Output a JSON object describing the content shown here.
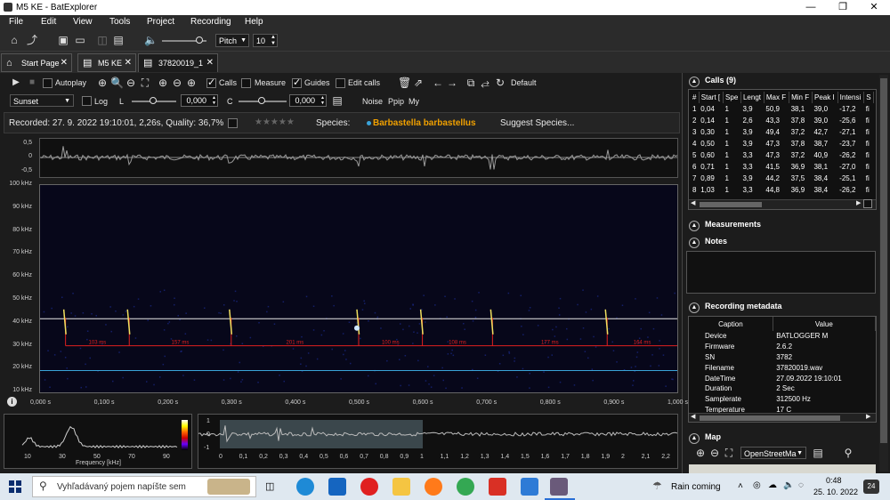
{
  "window": {
    "title": "M5 KE - BatExplorer",
    "minimize": "—",
    "maximize": "❐",
    "close": "✕"
  },
  "menu": [
    "File",
    "Edit",
    "View",
    "Tools",
    "Project",
    "Recording",
    "Help"
  ],
  "toolbar": {
    "pitch_label": "Pitch",
    "pitch_value": "10",
    "volume_level": 0.6
  },
  "tabs": [
    {
      "label": "Start Page",
      "icon": "home-icon"
    },
    {
      "label": "M5 KE",
      "icon": "project-icon"
    },
    {
      "label": "37820019_1",
      "icon": "recording-icon"
    }
  ],
  "controls": {
    "autoplay": "Autoplay",
    "calls": "Calls",
    "measure": "Measure",
    "guides": "Guides",
    "edit_calls": "Edit calls",
    "default": "Default",
    "palette": "Sunset",
    "log": "Log",
    "l_label": "L",
    "l_value": "0,000",
    "c_label": "C",
    "c_value": "0,000",
    "noise": "Noise",
    "ppip": "Ppip",
    "my": "My"
  },
  "info": {
    "recorded": "Recorded: 27. 9. 2022 19:10:01, 2,26s, Quality: 36,7%",
    "stars": "★★★★★",
    "species_label": "Species:",
    "species_value": "Barbastella barbastellus",
    "suggest": "Suggest Species..."
  },
  "waveform_ticks": [
    "0,5",
    "0",
    "-0,5"
  ],
  "spectrogram": {
    "freq_labels": [
      "100 kHz",
      "90 kHz",
      "80 kHz",
      "70 kHz",
      "60 kHz",
      "50 kHz",
      "40 kHz",
      "30 kHz",
      "20 kHz",
      "10 kHz"
    ],
    "time_labels": [
      "0,000 s",
      "0,100 s",
      "0,200 s",
      "0,300 s",
      "0,400 s",
      "0,500 s",
      "0,600 s",
      "0,700 s",
      "0,800 s",
      "0,900 s",
      "1,000 s"
    ],
    "intervals": [
      "103 ms",
      "157 ms",
      "201 ms",
      "100 ms",
      "108 ms",
      "177 ms",
      "164 ms"
    ],
    "call_times": [
      0.04,
      0.14,
      0.3,
      0.5,
      0.6,
      0.71,
      0.89
    ],
    "colors": {
      "guide_white": "#e8e8e8",
      "guide_blue": "#3aa3d8",
      "call_marker": "#e02020",
      "call_trace": "#f0e060",
      "species": "#f0a000"
    }
  },
  "spectrum": {
    "x_labels": [
      "10",
      "30",
      "50",
      "70",
      "90"
    ],
    "xlabel": "Frequency [kHz]"
  },
  "overview": {
    "y_labels": [
      "1",
      "0",
      "-1"
    ],
    "x_labels": [
      "0",
      "0,1",
      "0,2",
      "0,3",
      "0,4",
      "0,5",
      "0,6",
      "0,7",
      "0,8",
      "0,9",
      "1",
      "1,1",
      "1,2",
      "1,3",
      "1,4",
      "1,5",
      "1,6",
      "1,7",
      "1,8",
      "1,9",
      "2",
      "2,1",
      "2,2"
    ]
  },
  "calls_panel": {
    "title": "Calls (9)",
    "headers": [
      "#",
      "Start [",
      "Spe",
      "Lengt",
      "Max F",
      "Min F",
      "Peak I",
      "Intensi",
      "S"
    ],
    "rows": [
      [
        "1",
        "0,04",
        "1",
        "3,9",
        "50,9",
        "38,1",
        "39,0",
        "-17,2",
        "fi"
      ],
      [
        "2",
        "0,14",
        "1",
        "2,6",
        "43,3",
        "37,8",
        "39,0",
        "-25,6",
        "fi"
      ],
      [
        "3",
        "0,30",
        "1",
        "3,9",
        "49,4",
        "37,2",
        "42,7",
        "-27,1",
        "fi"
      ],
      [
        "4",
        "0,50",
        "1",
        "3,9",
        "47,3",
        "37,8",
        "38,7",
        "-23,7",
        "fi"
      ],
      [
        "5",
        "0,60",
        "1",
        "3,3",
        "47,3",
        "37,2",
        "40,9",
        "-26,2",
        "fi"
      ],
      [
        "6",
        "0,71",
        "1",
        "3,3",
        "41,5",
        "36,9",
        "38,1",
        "-27,0",
        "fi"
      ],
      [
        "7",
        "0,89",
        "1",
        "3,9",
        "44,2",
        "37,5",
        "38,4",
        "-25,1",
        "fi"
      ],
      [
        "8",
        "1,03",
        "1",
        "3,3",
        "44,8",
        "36,9",
        "38,4",
        "-26,2",
        "fi"
      ]
    ]
  },
  "measurements_title": "Measurements",
  "notes_title": "Notes",
  "metadata": {
    "title": "Recording metadata",
    "headers": [
      "Caption",
      "Value"
    ],
    "rows": [
      [
        "Device",
        "BATLOGGER M"
      ],
      [
        "Firmware",
        "2.6.2"
      ],
      [
        "SN",
        "3782"
      ],
      [
        "Filename",
        "37820019.wav"
      ],
      [
        "DateTime",
        "27.09.2022 19:10:01"
      ],
      [
        "Duration",
        "2 Sec"
      ],
      [
        "Samplerate",
        "312500 Hz"
      ],
      [
        "Temperature",
        "17 C"
      ]
    ]
  },
  "map": {
    "title": "Map",
    "provider": "OpenStreetMa"
  },
  "taskbar": {
    "search": "Vyhľadávaný pojem napíšte sem",
    "weather": "Rain coming",
    "time": "0:48",
    "date": "25. 10. 2022",
    "notifications": "24"
  }
}
